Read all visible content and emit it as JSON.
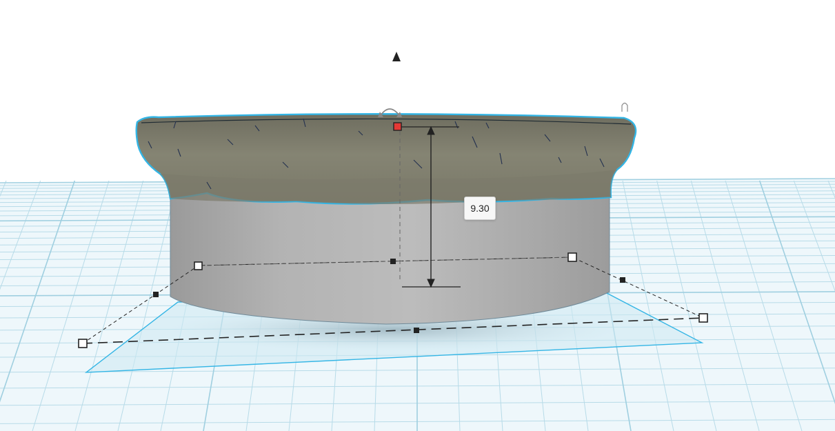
{
  "viewport": {
    "height_dimension_value": "9.30",
    "colors": {
      "background": "#ffffff",
      "grid_line": "#b9dce8",
      "grid_fill": "#eaf5f9",
      "selection_outline": "#33b5e5",
      "shape_side": "#a9a9a9",
      "shape_top": "#7b7a6a",
      "handle_active": "#e53935"
    },
    "icons": {
      "lift_handle": "triangle-up-icon",
      "rotate_handle": "rotate-arrow-icon"
    }
  }
}
